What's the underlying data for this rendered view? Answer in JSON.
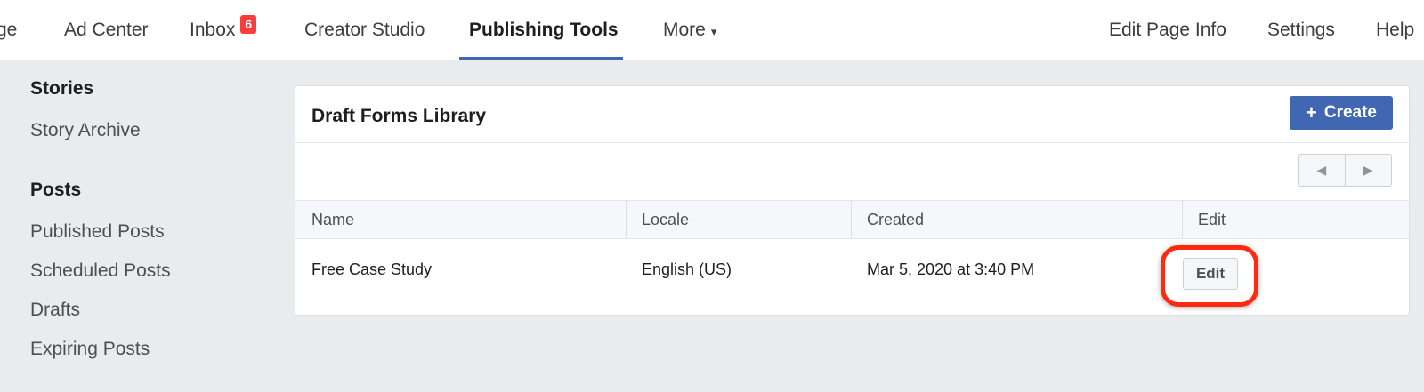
{
  "nav": {
    "items": [
      {
        "label": "ge"
      },
      {
        "label": "Ad Center"
      },
      {
        "label": "Inbox",
        "badge": "6"
      },
      {
        "label": "Creator Studio"
      },
      {
        "label": "Publishing Tools",
        "active": true
      },
      {
        "label": "More",
        "caret": "▾"
      },
      {
        "label": "Edit Page Info"
      },
      {
        "label": "Settings"
      },
      {
        "label": "Help"
      }
    ]
  },
  "sidebar": {
    "sections": [
      {
        "heading": "Stories",
        "links": [
          "Story Archive"
        ]
      },
      {
        "heading": "Posts",
        "links": [
          "Published Posts",
          "Scheduled Posts",
          "Drafts",
          "Expiring Posts"
        ]
      }
    ]
  },
  "panel": {
    "title": "Draft Forms Library",
    "create_label": "Create",
    "create_icon": "plus-icon",
    "pager": {
      "prev_icon": "triangle-left-icon",
      "next_icon": "triangle-right-icon"
    },
    "table": {
      "headers": [
        "Name",
        "Locale",
        "Created",
        "Edit"
      ],
      "rows": [
        {
          "name": "Free Case Study",
          "locale": "English (US)",
          "created": "Mar 5, 2020 at 3:40 PM",
          "edit_label": "Edit"
        }
      ]
    }
  },
  "colors": {
    "accent": "#4267b2",
    "badge": "#fa3e3e",
    "highlight": "#ff2a10",
    "background": "#e9ebee"
  }
}
